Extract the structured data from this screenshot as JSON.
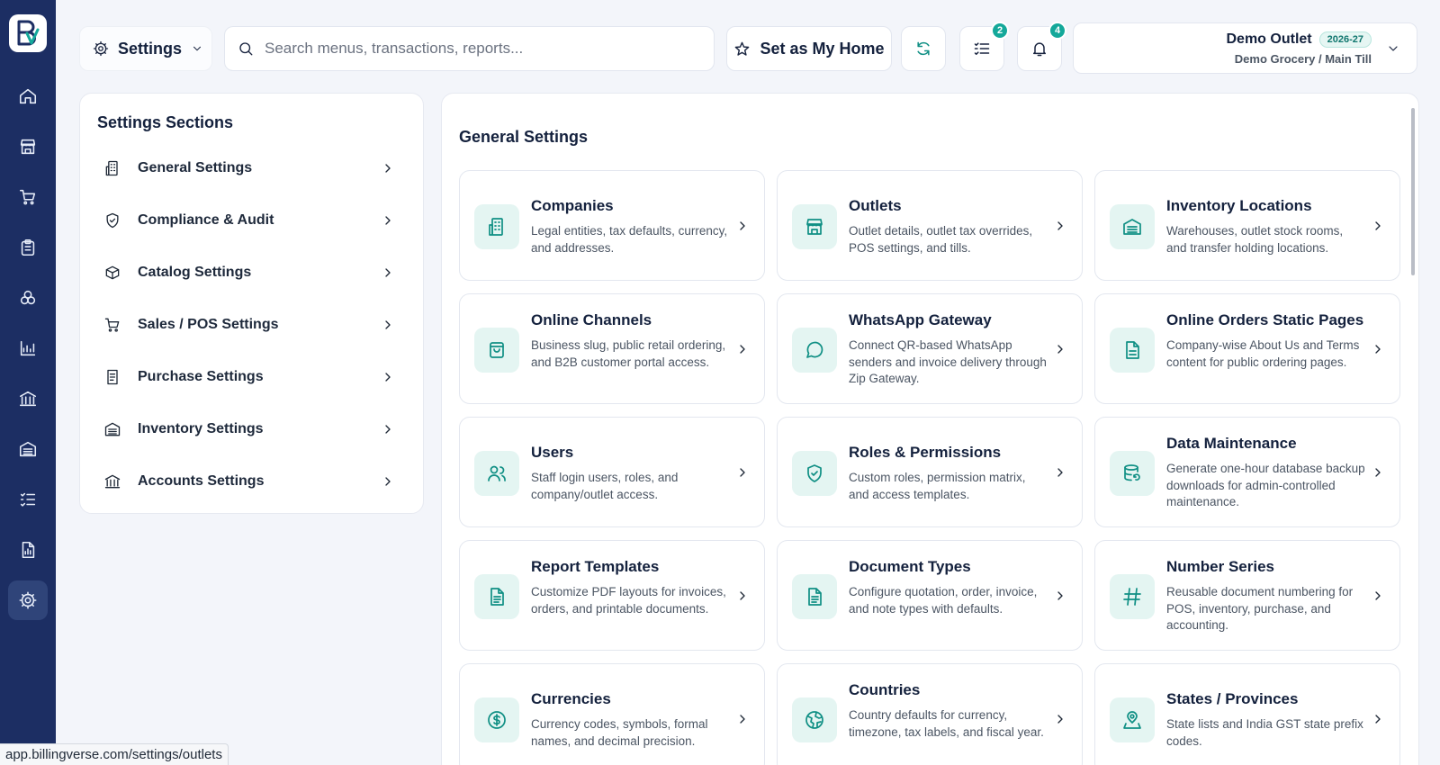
{
  "header": {
    "module_label": "Settings",
    "search_placeholder": "Search menus, transactions, reports...",
    "set_home_label": "Set as My Home",
    "tasks_badge": "2",
    "notifications_badge": "4",
    "outlet_name": "Demo Outlet",
    "financial_year": "2026-27",
    "outlet_sub": "Demo Grocery / Main Till"
  },
  "sidebar": {
    "items": [
      {
        "icon": "home-icon"
      },
      {
        "icon": "store-icon"
      },
      {
        "icon": "cart-icon"
      },
      {
        "icon": "clipboard-icon"
      },
      {
        "icon": "boxes-icon"
      },
      {
        "icon": "chart-icon"
      },
      {
        "icon": "bank-icon"
      },
      {
        "icon": "warehouse-icon"
      },
      {
        "icon": "list-check-icon"
      },
      {
        "icon": "report-icon"
      },
      {
        "icon": "gear-icon",
        "active": true
      }
    ]
  },
  "sections": {
    "title": "Settings Sections",
    "items": [
      {
        "label": "General Settings",
        "icon": "building-icon"
      },
      {
        "label": "Compliance & Audit",
        "icon": "shield-icon"
      },
      {
        "label": "Catalog Settings",
        "icon": "tag-box-icon"
      },
      {
        "label": "Sales / POS Settings",
        "icon": "cart-icon"
      },
      {
        "label": "Purchase Settings",
        "icon": "receipt-icon"
      },
      {
        "label": "Inventory Settings",
        "icon": "warehouse-icon"
      },
      {
        "label": "Accounts Settings",
        "icon": "bank-icon"
      }
    ]
  },
  "main": {
    "title": "General Settings",
    "cards": [
      {
        "title": "Companies",
        "desc": "Legal entities, tax defaults, currency, and addresses.",
        "icon": "building-icon"
      },
      {
        "title": "Outlets",
        "desc": "Outlet details, outlet tax overrides, POS settings, and tills.",
        "icon": "store-icon"
      },
      {
        "title": "Inventory Locations",
        "desc": "Warehouses, outlet stock rooms, and transfer holding locations.",
        "icon": "warehouse-icon"
      },
      {
        "title": "Online Channels",
        "desc": "Business slug, public retail ordering, and B2B customer portal access.",
        "icon": "shopping-bag-icon"
      },
      {
        "title": "WhatsApp Gateway",
        "desc": "Connect QR-based WhatsApp senders and invoice delivery through Zip Gateway.",
        "icon": "chat-bubble-icon"
      },
      {
        "title": "Online Orders Static Pages",
        "desc": "Company-wise About Us and Terms content for public ordering pages.",
        "icon": "document-icon"
      },
      {
        "title": "Users",
        "desc": "Staff login users, roles, and company/outlet access.",
        "icon": "users-icon"
      },
      {
        "title": "Roles & Permissions",
        "desc": "Custom roles, permission matrix, and access templates.",
        "icon": "shield-check-icon"
      },
      {
        "title": "Data Maintenance",
        "desc": "Generate one-hour database backup downloads for admin-controlled maintenance.",
        "icon": "database-icon"
      },
      {
        "title": "Report Templates",
        "desc": "Customize PDF layouts for invoices, orders, and printable documents.",
        "icon": "file-text-icon"
      },
      {
        "title": "Document Types",
        "desc": "Configure quotation, order, invoice, and note types with defaults.",
        "icon": "file-text-icon"
      },
      {
        "title": "Number Series",
        "desc": "Reusable document numbering for POS, inventory, purchase, and accounting.",
        "icon": "hash-icon"
      },
      {
        "title": "Currencies",
        "desc": "Currency codes, symbols, formal names, and decimal precision.",
        "icon": "currency-icon"
      },
      {
        "title": "Countries",
        "desc": "Country defaults for currency, timezone, tax labels, and fiscal year.",
        "icon": "globe-icon"
      },
      {
        "title": "States / Provinces",
        "desc": "State lists and India GST state prefix codes.",
        "icon": "map-pin-icon"
      }
    ]
  },
  "status_url": "app.billingverse.com/settings/outlets"
}
